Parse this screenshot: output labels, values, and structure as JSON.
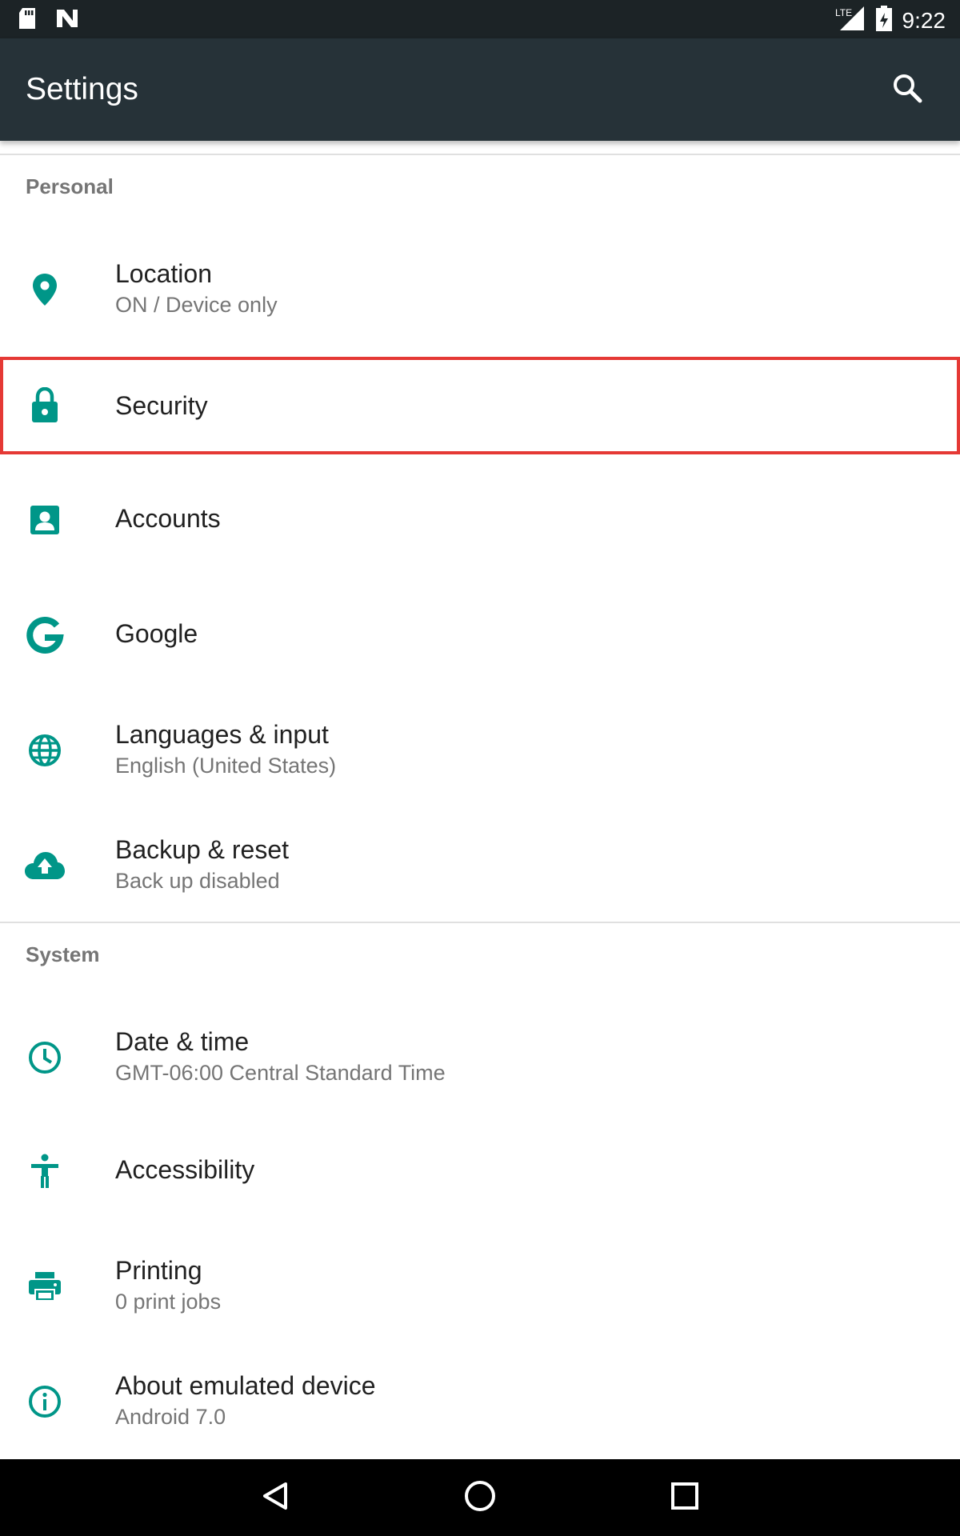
{
  "status_bar": {
    "time": "9:22",
    "icons": [
      "sd-card-icon",
      "n-logo-icon",
      "lte-signal-icon",
      "battery-icon"
    ],
    "lte_label": "LTE"
  },
  "app_bar": {
    "title": "Settings",
    "search_icon": "search-icon"
  },
  "sections": {
    "personal": {
      "header": "Personal",
      "items": [
        {
          "title": "Location",
          "subtitle": "ON / Device only",
          "icon": "location-pin-icon"
        },
        {
          "title": "Security",
          "subtitle": "",
          "icon": "lock-icon"
        },
        {
          "title": "Accounts",
          "subtitle": "",
          "icon": "account-box-icon"
        },
        {
          "title": "Google",
          "subtitle": "",
          "icon": "google-g-icon"
        },
        {
          "title": "Languages & input",
          "subtitle": "English (United States)",
          "icon": "globe-icon"
        },
        {
          "title": "Backup & reset",
          "subtitle": "Back up disabled",
          "icon": "cloud-upload-icon"
        }
      ]
    },
    "system": {
      "header": "System",
      "items": [
        {
          "title": "Date & time",
          "subtitle": "GMT-06:00 Central Standard Time",
          "icon": "clock-icon"
        },
        {
          "title": "Accessibility",
          "subtitle": "",
          "icon": "accessibility-icon"
        },
        {
          "title": "Printing",
          "subtitle": "0 print jobs",
          "icon": "printer-icon"
        },
        {
          "title": "About emulated device",
          "subtitle": "Android 7.0",
          "icon": "info-icon"
        }
      ]
    }
  },
  "nav_bar": {
    "back_icon": "back-triangle-icon",
    "home_icon": "home-circle-icon",
    "recents_icon": "recents-square-icon"
  },
  "colors": {
    "accent": "#009688",
    "app_bar": "#263238",
    "status_bar": "#1c2326",
    "highlight": "#e53935"
  }
}
